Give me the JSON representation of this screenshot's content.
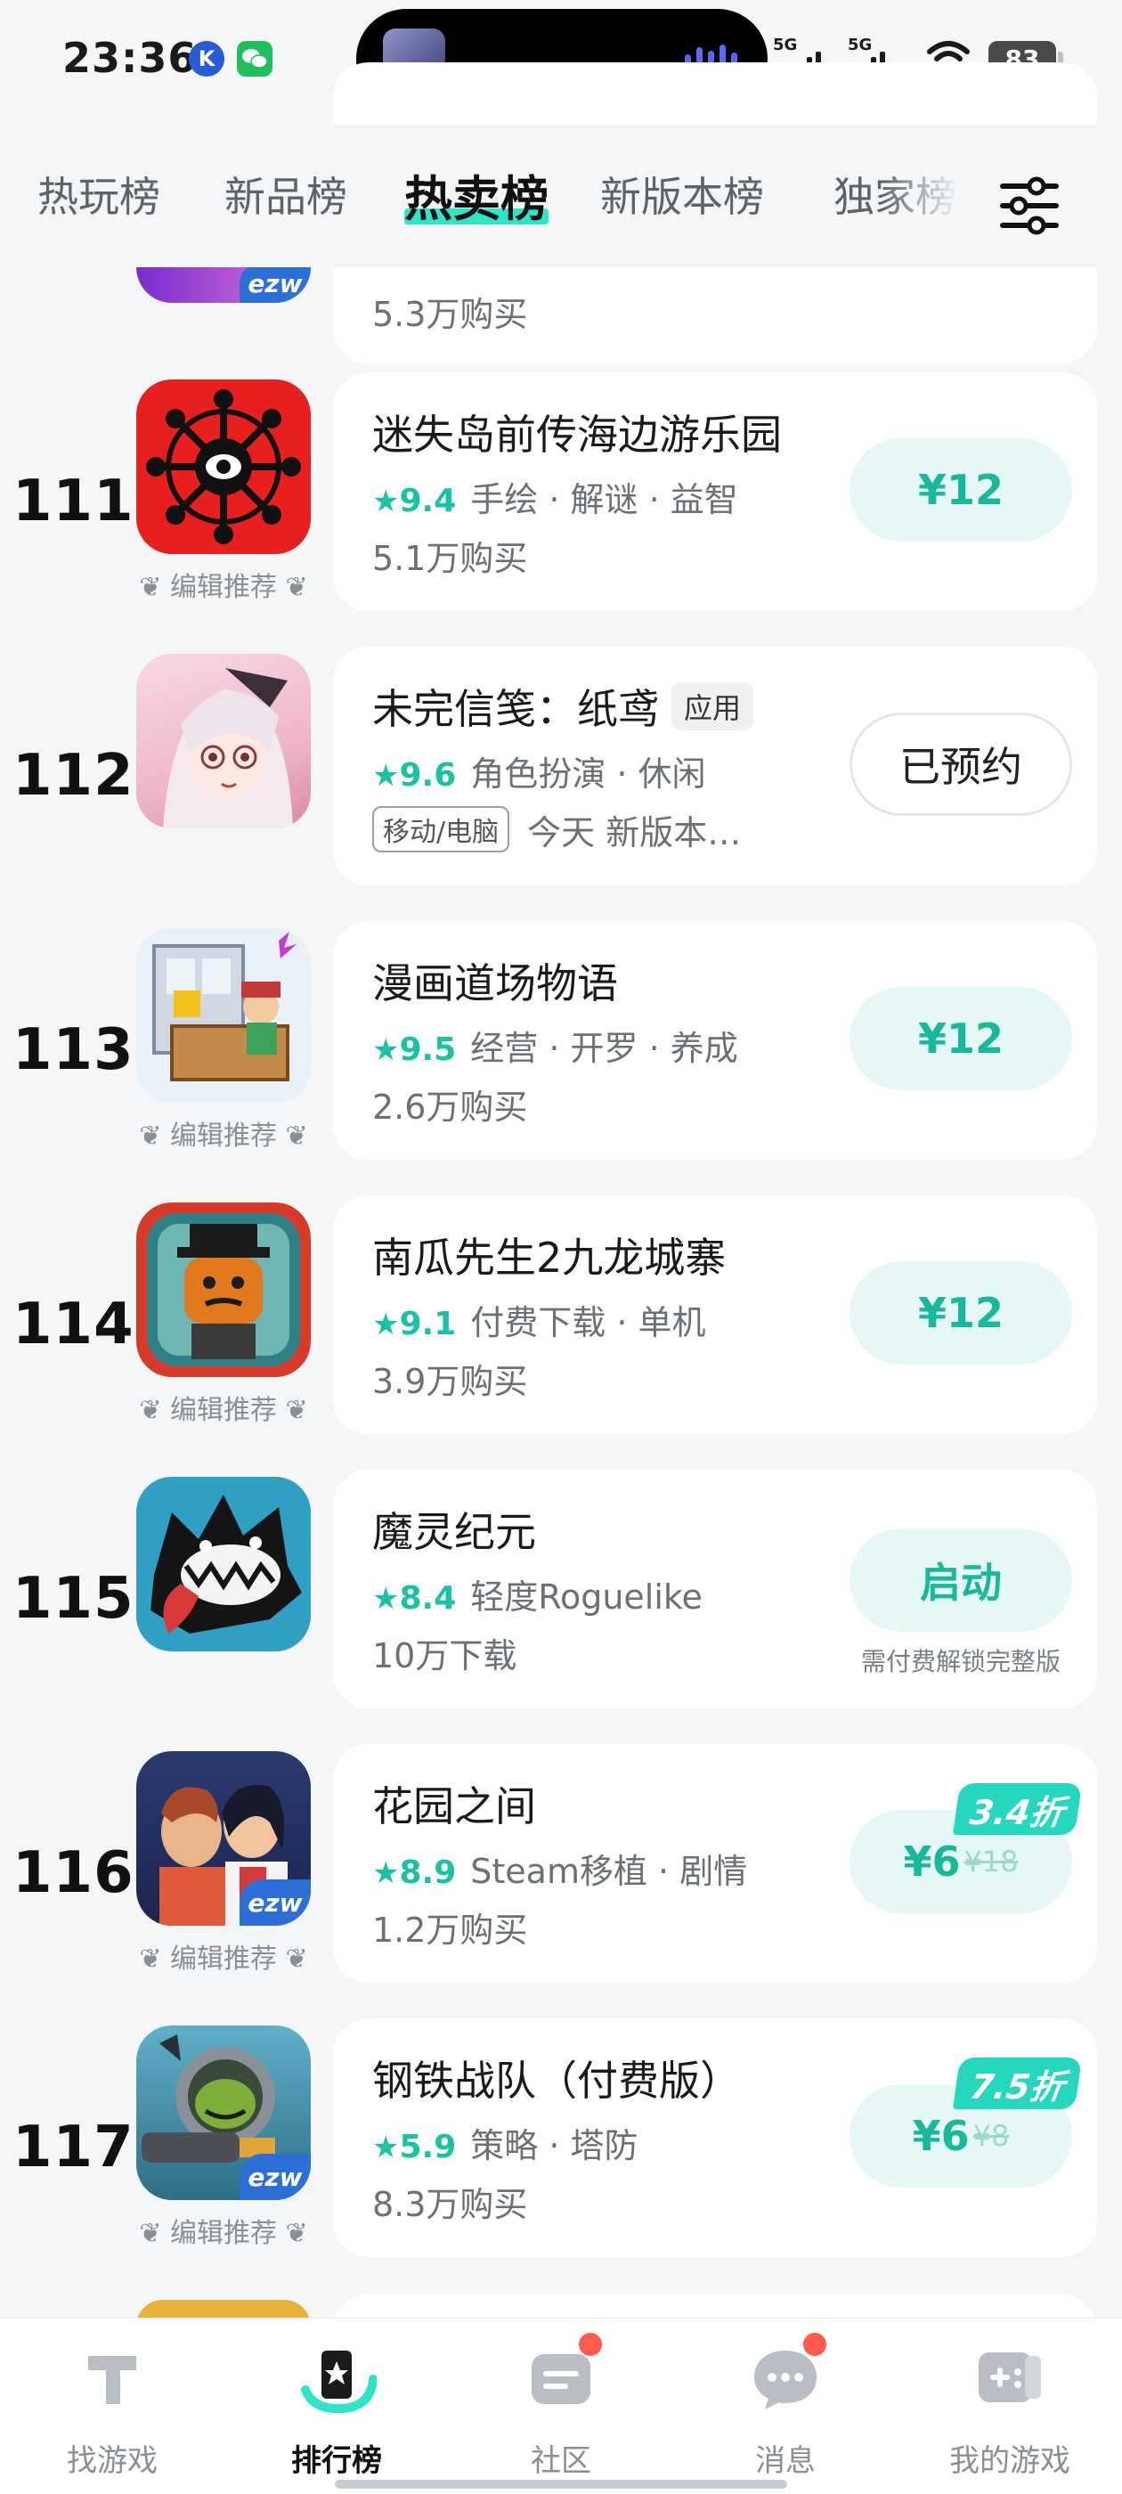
{
  "status_bar": {
    "time": "23:36",
    "network1": "5G",
    "network2": "5G",
    "battery": "83"
  },
  "tabs": [
    {
      "label": "热玩榜",
      "active": false
    },
    {
      "label": "新品榜",
      "active": false
    },
    {
      "label": "热卖榜",
      "active": true
    },
    {
      "label": "新版本榜",
      "active": false
    },
    {
      "label": "独家榜",
      "active": false
    }
  ],
  "list": {
    "top_partial": {
      "sub": "5.3万购买"
    },
    "items": [
      {
        "rank": "111",
        "title": "迷失岛前传海边游乐园",
        "score": "9.4",
        "tags": "手绘 · 解谜 · 益智",
        "sub": "5.1万购买",
        "editor": "编辑推荐",
        "button": "¥12"
      },
      {
        "rank": "112",
        "title": "未完信笺：纸鸢",
        "tag": "应用",
        "score": "9.6",
        "tags": "角色扮演 · 休闲",
        "platform": "移动/电脑",
        "sub": "今天 新版本…",
        "button": "已预约"
      },
      {
        "rank": "113",
        "title": "漫画道场物语",
        "score": "9.5",
        "tags": "经营 · 开罗 · 养成",
        "sub": "2.6万购买",
        "editor": "编辑推荐",
        "button": "¥12"
      },
      {
        "rank": "114",
        "title": "南瓜先生2九龙城寨",
        "score": "9.1",
        "tags": "付费下载 · 单机",
        "sub": "3.9万购买",
        "editor": "编辑推荐",
        "button": "¥12"
      },
      {
        "rank": "115",
        "title": "魔灵纪元",
        "score": "8.4",
        "tags": "轻度Roguelike",
        "sub": "10万下载",
        "button": "启动",
        "button_note": "需付费解锁完整版"
      },
      {
        "rank": "116",
        "title": "花园之间",
        "score": "8.9",
        "tags": "Steam移植 · 剧情",
        "sub": "1.2万购买",
        "editor": "编辑推荐",
        "button": "¥6",
        "orig_price": "¥18",
        "discount": "3.4折"
      },
      {
        "rank": "117",
        "title": "钢铁战队（付费版）",
        "score": "5.9",
        "tags": "策略 · 塔防",
        "sub": "8.3万购买",
        "editor": "编辑推荐",
        "button": "¥6",
        "orig_price": "¥8",
        "discount": "7.5折"
      }
    ]
  },
  "badge_ezw": "ezw",
  "bottom_nav": [
    {
      "label": "找游戏",
      "icon": "find-game-icon"
    },
    {
      "label": "排行榜",
      "icon": "ranking-icon",
      "active": true
    },
    {
      "label": "社区",
      "icon": "community-icon",
      "dot": true
    },
    {
      "label": "消息",
      "icon": "message-icon",
      "dot": true
    },
    {
      "label": "我的游戏",
      "icon": "my-games-icon"
    }
  ],
  "colors": {
    "accent": "#19c2a2",
    "highlight": "#2ee6c7",
    "background": "#f4f6f8",
    "button_bg": "#e6f8f6",
    "dot": "#ff5a4e"
  }
}
